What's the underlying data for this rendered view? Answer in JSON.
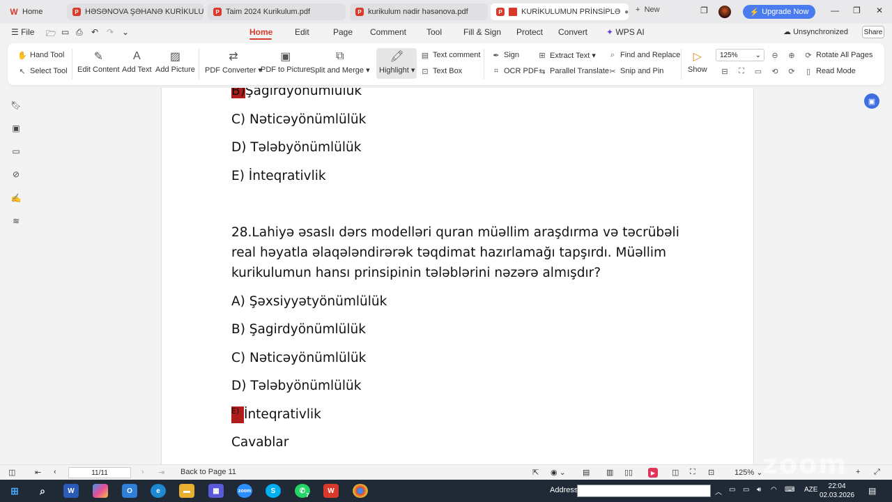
{
  "tabs": [
    {
      "label": "Home",
      "icon": "wps-logo-icon"
    },
    {
      "label": "HƏSƏNOVA ŞƏHANƏ KURİKULUM V"
    },
    {
      "label": "Taim 2024 Kurikulum.pdf"
    },
    {
      "label": "kurikulum nədir həsənova.pdf"
    },
    {
      "label": "KURİKULUMUN PRİNSİPLƏ"
    }
  ],
  "new_tab": "New",
  "upgrade": "Upgrade Now",
  "menu": {
    "file": "File",
    "items": [
      "Home",
      "Edit",
      "Page",
      "Comment",
      "Tool",
      "Fill & Sign",
      "Protect",
      "Convert",
      "WPS AI"
    ],
    "sync": "Unsynchronized",
    "share": "Share"
  },
  "ribbon": {
    "hand_tool": "Hand Tool",
    "select_tool": "Select Tool",
    "edit_content": "Edit Content",
    "add_text": "Add Text",
    "add_picture": "Add Picture",
    "pdf_converter": "PDF Converter",
    "pdf_to_picture": "PDF to Picture",
    "split_merge": "Split and Merge",
    "highlight": "Highlight",
    "text_comment": "Text comment",
    "text_box": "Text Box",
    "sign": "Sign",
    "ocr_pdf": "OCR PDF",
    "extract_text": "Extract Text",
    "parallel_translate": "Parallel Translate",
    "find_replace": "Find and Replace",
    "snip_pin": "Snip and Pin",
    "show": "Show",
    "zoom": "125%",
    "rotate_all": "Rotate All Pages",
    "read_mode": "Read Mode"
  },
  "document": {
    "top_b_prefix": "B)",
    "top_b": "Şagirdyönümlülük",
    "top_c": "C) Nəticəyönümlülük",
    "top_d": "D) Tələbyönümlülük",
    "top_e": "E) İnteqrativlik",
    "q28_line1": "28.Lahiyə əsaslı dərs modelləri quran müəllim araşdırma və təcrübəli",
    "q28_line2": "real həyatla əlaqələndirərək təqdimat hazırlamağı tapşırdı.  Müəllim",
    "q28_line3": "kurikulumun hansı prinsipinin tələblərini nəzərə almışdır?",
    "a": "A) Şəxsiyyətyönümlülük",
    "b": "B) Şagirdyönümlülük",
    "c": "C) Nəticəyönümlülük",
    "d": "D) Tələbyönümlülük",
    "e_prefix": "E)",
    "e": "İnteqrativlik",
    "answers": "Cavablar"
  },
  "status": {
    "page": "11/11",
    "back": "Back to Page 11",
    "zoom": "125%"
  },
  "taskbar": {
    "address_label": "Address",
    "lang": "AZE",
    "time": "22:04",
    "date": "02.03.2026",
    "whatsapp_badge": "7"
  },
  "colors": {
    "accent": "#d93a2b",
    "highlight_box": "#b01c1c",
    "upgrade": "#4a7cf0"
  }
}
